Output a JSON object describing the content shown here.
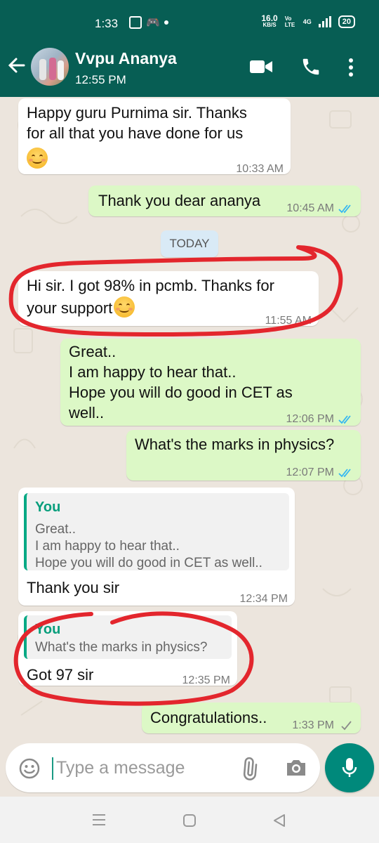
{
  "status_bar": {
    "time": "1:33",
    "net_speed_value": "16.0",
    "net_speed_unit": "KB/S",
    "volte": "Vo LTE",
    "network": "4G",
    "battery": "20"
  },
  "header": {
    "contact_name": "Vvpu Ananya",
    "last_seen": "12:55 PM"
  },
  "date_chip": "TODAY",
  "messages": [
    {
      "direction": "in",
      "lines": [
        "Happy guru Purnima sir. Thanks",
        "for all that you have done for us"
      ],
      "emoji": true,
      "time": "10:33 AM"
    },
    {
      "direction": "out",
      "text": "Thank you dear ananya",
      "time": "10:45 AM"
    },
    {
      "direction": "in",
      "lines": [
        "Hi sir. I got 98% in pcmb. Thanks for",
        "your support"
      ],
      "time": "11:55 AM"
    },
    {
      "direction": "out",
      "lines": [
        "Great..",
        "I am happy to hear that..",
        "Hope you will do good in CET as",
        "well.."
      ],
      "time": "12:06 PM"
    },
    {
      "direction": "out",
      "text": "What's the marks in physics?",
      "time": "12:07 PM"
    },
    {
      "direction": "in",
      "quote_author": "You",
      "quote_lines": [
        "Great..",
        "I am happy to hear that..",
        "Hope you will do good in CET as well.."
      ],
      "text": "Thank you sir",
      "time": "12:34 PM"
    },
    {
      "direction": "in",
      "quote_author": "You",
      "quote_lines": [
        "What's the marks in physics?"
      ],
      "text": "Got 97 sir",
      "time": "12:35 PM"
    },
    {
      "direction": "out",
      "text": "Congratulations..",
      "time": "1:33 PM"
    }
  ],
  "composer": {
    "placeholder": "Type a message"
  },
  "colors": {
    "header": "#075e54",
    "outgoing_bubble": "#dcf8c6",
    "incoming_bubble": "#ffffff",
    "chat_background": "#ece5dd",
    "read_tick": "#34b7f1",
    "annotation": "#e3262d",
    "mic_button": "#00897b"
  },
  "icons": [
    "back-arrow-icon",
    "video-call-icon",
    "voice-call-icon",
    "more-options-icon",
    "emoji-icon",
    "attach-icon",
    "camera-icon",
    "mic-icon",
    "nav-menu-icon",
    "nav-home-icon",
    "nav-back-icon"
  ]
}
